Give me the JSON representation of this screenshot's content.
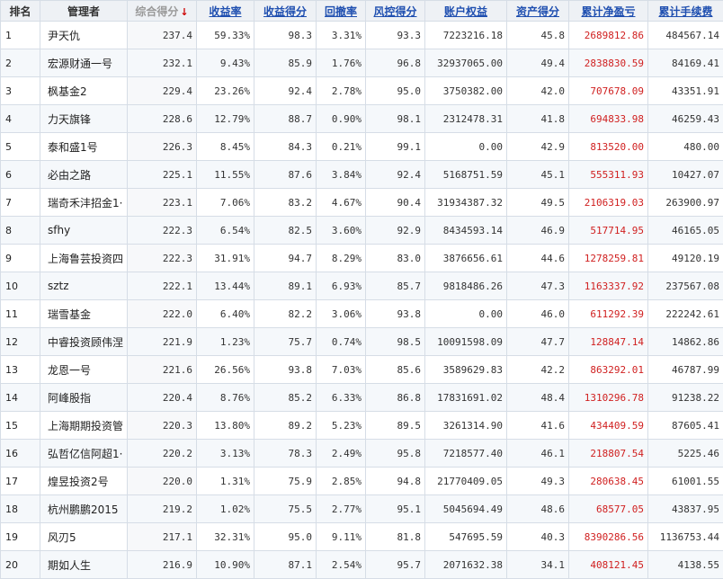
{
  "headers": {
    "rank": "排名",
    "manager": "管理者",
    "composite": "综合得分",
    "return_rate": "收益率",
    "return_score": "收益得分",
    "drawdown": "回撤率",
    "risk_score": "风控得分",
    "account_equity": "账户权益",
    "asset_score": "资产得分",
    "cum_pnl": "累计净盈亏",
    "cum_fee": "累计手续费"
  },
  "sort_icon": "↓",
  "colors": {
    "header_link": "#1f4fb0",
    "pnl": "#d02020",
    "sort_arrow": "#cc0000"
  },
  "rows": [
    {
      "rank": "1",
      "manager": "尹天仇",
      "composite": "237.4",
      "return_rate": "59.33%",
      "return_score": "98.3",
      "drawdown": "3.31%",
      "risk_score": "93.3",
      "equity": "7223216.18",
      "asset_score": "45.8",
      "pnl": "2689812.86",
      "fee": "484567.14"
    },
    {
      "rank": "2",
      "manager": "宏源财通一号",
      "composite": "232.1",
      "return_rate": "9.43%",
      "return_score": "85.9",
      "drawdown": "1.76%",
      "risk_score": "96.8",
      "equity": "32937065.00",
      "asset_score": "49.4",
      "pnl": "2838830.59",
      "fee": "84169.41"
    },
    {
      "rank": "3",
      "manager": "枫基金2",
      "composite": "229.4",
      "return_rate": "23.26%",
      "return_score": "92.4",
      "drawdown": "2.78%",
      "risk_score": "95.0",
      "equity": "3750382.00",
      "asset_score": "42.0",
      "pnl": "707678.09",
      "fee": "43351.91"
    },
    {
      "rank": "4",
      "manager": "力天旗锋",
      "composite": "228.6",
      "return_rate": "12.79%",
      "return_score": "88.7",
      "drawdown": "0.90%",
      "risk_score": "98.1",
      "equity": "2312478.31",
      "asset_score": "41.8",
      "pnl": "694833.98",
      "fee": "46259.43"
    },
    {
      "rank": "5",
      "manager": "泰和盛1号",
      "composite": "226.3",
      "return_rate": "8.45%",
      "return_score": "84.3",
      "drawdown": "0.21%",
      "risk_score": "99.1",
      "equity": "0.00",
      "asset_score": "42.9",
      "pnl": "813520.00",
      "fee": "480.00"
    },
    {
      "rank": "6",
      "manager": "必由之路",
      "composite": "225.1",
      "return_rate": "11.55%",
      "return_score": "87.6",
      "drawdown": "3.84%",
      "risk_score": "92.4",
      "equity": "5168751.59",
      "asset_score": "45.1",
      "pnl": "555311.93",
      "fee": "10427.07"
    },
    {
      "rank": "7",
      "manager": "瑞奇禾沣招金1·",
      "composite": "223.1",
      "return_rate": "7.06%",
      "return_score": "83.2",
      "drawdown": "4.67%",
      "risk_score": "90.4",
      "equity": "31934387.32",
      "asset_score": "49.5",
      "pnl": "2106319.03",
      "fee": "263900.97"
    },
    {
      "rank": "8",
      "manager": "sfhy",
      "composite": "222.3",
      "return_rate": "6.54%",
      "return_score": "82.5",
      "drawdown": "3.60%",
      "risk_score": "92.9",
      "equity": "8434593.14",
      "asset_score": "46.9",
      "pnl": "517714.95",
      "fee": "46165.05"
    },
    {
      "rank": "9",
      "manager": "上海鲁芸投资四",
      "composite": "222.3",
      "return_rate": "31.91%",
      "return_score": "94.7",
      "drawdown": "8.29%",
      "risk_score": "83.0",
      "equity": "3876656.61",
      "asset_score": "44.6",
      "pnl": "1278259.81",
      "fee": "49120.19"
    },
    {
      "rank": "10",
      "manager": "sztz",
      "composite": "222.1",
      "return_rate": "13.44%",
      "return_score": "89.1",
      "drawdown": "6.93%",
      "risk_score": "85.7",
      "equity": "9818486.26",
      "asset_score": "47.3",
      "pnl": "1163337.92",
      "fee": "237567.08"
    },
    {
      "rank": "11",
      "manager": "瑞雪基金",
      "composite": "222.0",
      "return_rate": "6.40%",
      "return_score": "82.2",
      "drawdown": "3.06%",
      "risk_score": "93.8",
      "equity": "0.00",
      "asset_score": "46.0",
      "pnl": "611292.39",
      "fee": "222242.61"
    },
    {
      "rank": "12",
      "manager": "中睿投资顾伟涅",
      "composite": "221.9",
      "return_rate": "1.23%",
      "return_score": "75.7",
      "drawdown": "0.74%",
      "risk_score": "98.5",
      "equity": "10091598.09",
      "asset_score": "47.7",
      "pnl": "128847.14",
      "fee": "14862.86"
    },
    {
      "rank": "13",
      "manager": "龙恩一号",
      "composite": "221.6",
      "return_rate": "26.56%",
      "return_score": "93.8",
      "drawdown": "7.03%",
      "risk_score": "85.6",
      "equity": "3589629.83",
      "asset_score": "42.2",
      "pnl": "863292.01",
      "fee": "46787.99"
    },
    {
      "rank": "14",
      "manager": "阿峰股指",
      "composite": "220.4",
      "return_rate": "8.76%",
      "return_score": "85.2",
      "drawdown": "6.33%",
      "risk_score": "86.8",
      "equity": "17831691.02",
      "asset_score": "48.4",
      "pnl": "1310296.78",
      "fee": "91238.22"
    },
    {
      "rank": "15",
      "manager": "上海期期投资管",
      "composite": "220.3",
      "return_rate": "13.80%",
      "return_score": "89.2",
      "drawdown": "5.23%",
      "risk_score": "89.5",
      "equity": "3261314.90",
      "asset_score": "41.6",
      "pnl": "434409.59",
      "fee": "87605.41"
    },
    {
      "rank": "16",
      "manager": "弘哲亿信阿超1·",
      "composite": "220.2",
      "return_rate": "3.13%",
      "return_score": "78.3",
      "drawdown": "2.49%",
      "risk_score": "95.8",
      "equity": "7218577.40",
      "asset_score": "46.1",
      "pnl": "218807.54",
      "fee": "5225.46"
    },
    {
      "rank": "17",
      "manager": "煌昱投资2号",
      "composite": "220.0",
      "return_rate": "1.31%",
      "return_score": "75.9",
      "drawdown": "2.85%",
      "risk_score": "94.8",
      "equity": "21770409.05",
      "asset_score": "49.3",
      "pnl": "280638.45",
      "fee": "61001.55"
    },
    {
      "rank": "18",
      "manager": "杭州鹏鹏2015",
      "composite": "219.2",
      "return_rate": "1.02%",
      "return_score": "75.5",
      "drawdown": "2.77%",
      "risk_score": "95.1",
      "equity": "5045694.49",
      "asset_score": "48.6",
      "pnl": "68577.05",
      "fee": "43837.95"
    },
    {
      "rank": "19",
      "manager": "风刃5",
      "composite": "217.1",
      "return_rate": "32.31%",
      "return_score": "95.0",
      "drawdown": "9.11%",
      "risk_score": "81.8",
      "equity": "547695.59",
      "asset_score": "40.3",
      "pnl": "8390286.56",
      "fee": "1136753.44"
    },
    {
      "rank": "20",
      "manager": "期如人生",
      "composite": "216.9",
      "return_rate": "10.90%",
      "return_score": "87.1",
      "drawdown": "2.54%",
      "risk_score": "95.7",
      "equity": "2071632.38",
      "asset_score": "34.1",
      "pnl": "408121.45",
      "fee": "4138.55"
    }
  ]
}
